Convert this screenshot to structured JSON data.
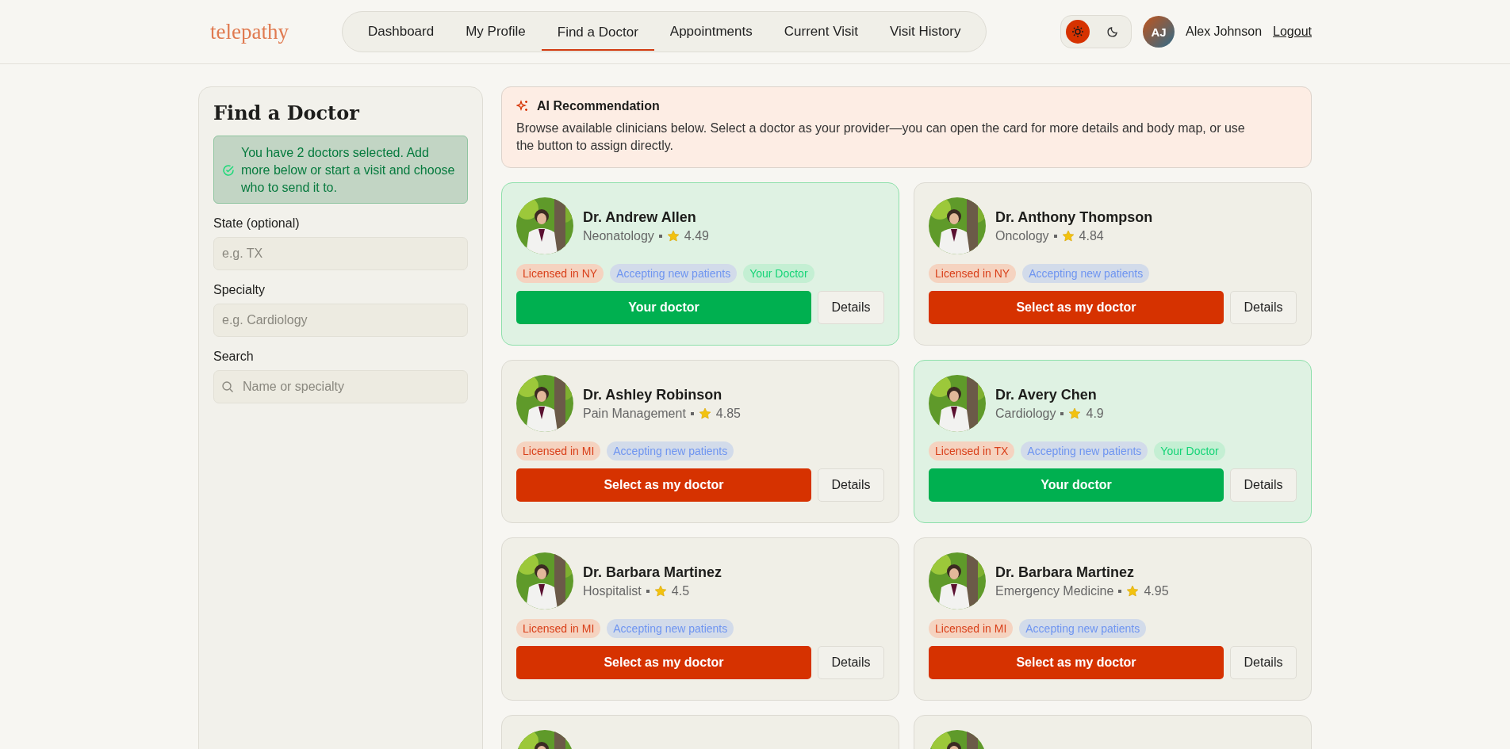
{
  "header": {
    "logo": "telepathy",
    "nav": [
      {
        "label": "Dashboard",
        "selected": false
      },
      {
        "label": "My Profile",
        "selected": false
      },
      {
        "label": "Find a Doctor",
        "selected": true
      },
      {
        "label": "Appointments",
        "selected": false
      },
      {
        "label": "Current Visit",
        "selected": false
      },
      {
        "label": "Visit History",
        "selected": false
      }
    ],
    "theme_toggle": [
      {
        "kind": "sun",
        "selected": true
      },
      {
        "kind": "moon",
        "selected": false
      }
    ],
    "avatar_initials": "AJ",
    "user_name": "Alex Johnson",
    "logout": "Logout"
  },
  "filters": {
    "title": "Find a Doctor",
    "notice": "You have 2 doctors selected. Add more below or start a visit and choose who to send it to.",
    "fields": [
      {
        "label": "State (optional)",
        "placeholder": "e.g. TX",
        "kind": "text"
      },
      {
        "label": "Specialty",
        "placeholder": "e.g. Cardiology",
        "kind": "text"
      },
      {
        "label": "Search",
        "placeholder": "Name or specialty",
        "kind": "search"
      }
    ]
  },
  "recommendation": {
    "title": "AI Recommendation",
    "text": "Browse available clinicians below. Select a doctor as your provider—you can open the card for more details and body map, or use the button to assign directly."
  },
  "doctors": [
    {
      "kind": "full",
      "name": "Dr. Andrew Allen",
      "specialty": "Neonatology",
      "rating": "4.49",
      "selected": true,
      "tags": [
        {
          "kind": "license",
          "label": "Licensed in NY"
        },
        {
          "kind": "accepting",
          "label": "Accepting new patients"
        },
        {
          "kind": "mine",
          "label": "Your Doctor"
        }
      ],
      "button": "Your doctor",
      "details": "Details"
    },
    {
      "kind": "full",
      "name": "Dr. Anthony Thompson",
      "specialty": "Oncology",
      "rating": "4.84",
      "selected": false,
      "tags": [
        {
          "kind": "license",
          "label": "Licensed in NY"
        },
        {
          "kind": "accepting",
          "label": "Accepting new patients"
        }
      ],
      "button": "Select as my doctor",
      "details": "Details"
    },
    {
      "kind": "full",
      "name": "Dr. Ashley Robinson",
      "specialty": "Pain Management",
      "rating": "4.85",
      "selected": false,
      "tags": [
        {
          "kind": "license",
          "label": "Licensed in MI"
        },
        {
          "kind": "accepting",
          "label": "Accepting new patients"
        }
      ],
      "button": "Select as my doctor",
      "details": "Details"
    },
    {
      "kind": "full",
      "name": "Dr. Avery Chen",
      "specialty": "Cardiology",
      "rating": "4.9",
      "selected": true,
      "tags": [
        {
          "kind": "license",
          "label": "Licensed in TX"
        },
        {
          "kind": "accepting",
          "label": "Accepting new patients"
        },
        {
          "kind": "mine",
          "label": "Your Doctor"
        }
      ],
      "button": "Your doctor",
      "details": "Details"
    },
    {
      "kind": "full",
      "name": "Dr. Barbara Martinez",
      "specialty": "Hospitalist",
      "rating": "4.5",
      "selected": false,
      "tags": [
        {
          "kind": "license",
          "label": "Licensed in MI"
        },
        {
          "kind": "accepting",
          "label": "Accepting new patients"
        }
      ],
      "button": "Select as my doctor",
      "details": "Details"
    },
    {
      "kind": "full",
      "name": "Dr. Barbara Martinez",
      "specialty": "Emergency Medicine",
      "rating": "4.95",
      "selected": false,
      "tags": [
        {
          "kind": "license",
          "label": "Licensed in MI"
        },
        {
          "kind": "accepting",
          "label": "Accepting new patients"
        }
      ],
      "button": "Select as my doctor",
      "details": "Details"
    },
    {
      "kind": "partial"
    },
    {
      "kind": "partial"
    }
  ]
}
